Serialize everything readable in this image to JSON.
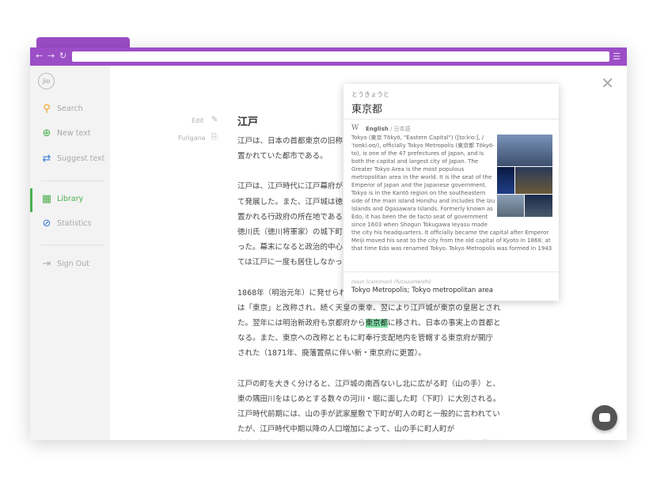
{
  "sidebar": {
    "logo": "jio",
    "items": [
      {
        "label": "Search",
        "icon": "search-icon"
      },
      {
        "label": "New text",
        "icon": "plus-circle-icon"
      },
      {
        "label": "Suggest text",
        "icon": "shuffle-icon"
      },
      {
        "label": "Library",
        "icon": "library-icon",
        "active": true
      },
      {
        "label": "Statistics",
        "icon": "compass-icon"
      },
      {
        "label": "Sign Out",
        "icon": "sign-out-icon"
      }
    ]
  },
  "reader": {
    "edit_label": "Edit",
    "furigana_label": "Furigana",
    "title": "江戸",
    "paragraphs": [
      "江戸は、日本の首都東京の旧称\n置かれていた都市である。",
      "江戸は、江戸時代に江戸幕府が\nて発展した。また、江戸城は徳\n置かれる行政府の所在地である\n徳川氏（徳川将軍家）の城下町\nった。幕末になると政治的中心\nては江戸に一度も居住しなかっ",
      "1868年（明治元年）に発せられ\nは「東京」と改称され、続く天皇の東幸、翌により江戸城が東京の皇居とされ\nた。翌年には明治新政府も京都府から",
      "江戸の町を大きく分けると、江戸城の南西ないし北に広がる町（山の手）と、\n東の隅田川をはじめとする数々の河川・堀に面した町（下町）に大別される。\n江戸時代前期には、山の手が武家屋敷で下町が町人の町と一般的に言われてい\nたが、江戸時代中期以降の人口増加によって、山の手に町人町が\n存在（千代田区の一部が挙げられる。）したり、逆に下町に多くの武家屋敷が"
    ],
    "para3_highlight": "東京都",
    "para3_after": "に移され、日本の事実上の首都と\nなる。また、東京への改称とともに町奉行支配地内を管轄する東京府が開庁\nされた（1871年、廃藩置県に伴い新・東京府に更置）。"
  },
  "popup": {
    "reading": "とうきょうと",
    "word": "東京都",
    "source_icon": "W",
    "lang_active": "English",
    "lang_other": " / 日本語",
    "description_top": "Tokyo (東京 Tōkyō, \"Eastern Capital\") ([toːkʲoː], /ˈtoʊki.oʊ/), officially Tokyo Metropolis (東京都 Tōkyō-to), is one of the 47 prefectures of Japan, and is both the capital and largest city of Japan. The Greater Tokyo Area is the most populous metropolitan area in the world. It is the seat of the Emperor of Japan and the Japanese government. Tokyo is in the Kantō region on the southeastern side of the main island Honshu and includes the Izu Islands and Ogasawara Islands. Formerly known as Edo, it has been the de facto seat of government since 1603 when Shogun Tokugawa Ieyasu made",
    "description_bottom": "the city his headquarters. It officially became the capital after Emperor Meiji moved his seat to the city from the old capital of Kyoto in 1868; at that time Edo was renamed Tokyo. Tokyo Metropolis was formed in 1943",
    "pos": "noun (common) (futsuumeishi)",
    "definition": "Tokyo Metropolis; Tokyo metropolitan area"
  },
  "colors": {
    "accent": "#9c4ec7",
    "active": "#4caf50",
    "highlight": "#7ee0a7"
  }
}
